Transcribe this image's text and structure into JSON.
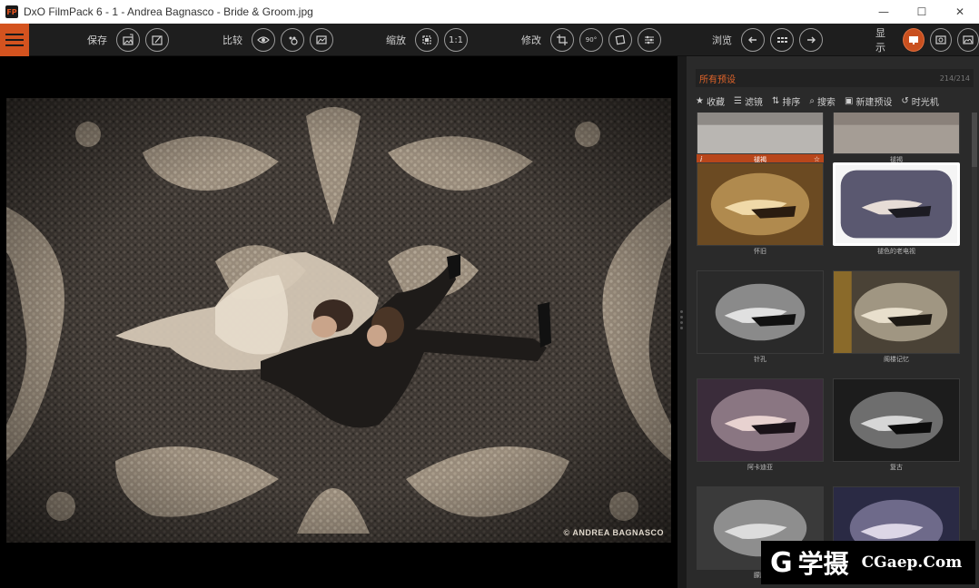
{
  "window": {
    "logo_text": "FP",
    "title": "DxO FilmPack 6 - 1 - Andrea Bagnasco - Bride & Groom.jpg",
    "minimize": "—",
    "maximize": "☐",
    "close": "✕"
  },
  "toolbar": {
    "save_label": "保存",
    "compare_label": "比较",
    "zoom_label": "缩放",
    "zoom_ratio": "1:1",
    "edit_label": "修改",
    "rotate_label": "90°",
    "browse_label": "浏览",
    "display_label": "显示"
  },
  "photo": {
    "credit": "© ANDREA BAGNASCO"
  },
  "panel": {
    "title": "所有预设",
    "count": "214/214",
    "tools": [
      {
        "icon": "★",
        "label": "收藏"
      },
      {
        "icon": "☰",
        "label": "滤镜"
      },
      {
        "icon": "⇅",
        "label": "排序"
      },
      {
        "icon": "⌕",
        "label": "搜索"
      },
      {
        "icon": "▣",
        "label": "新建预设"
      },
      {
        "icon": "↺",
        "label": "时光机"
      }
    ],
    "presets": [
      {
        "label": "褪褐",
        "selected": true
      },
      {
        "label": "褪褐"
      },
      {
        "label": "怀旧"
      },
      {
        "label": "褪色的老电视",
        "framed": true
      },
      {
        "label": "针孔"
      },
      {
        "label": "阁楼记忆"
      },
      {
        "label": "阿卡迪亚"
      },
      {
        "label": "复古"
      },
      {
        "label": "朦胧"
      },
      {
        "label": ""
      }
    ]
  },
  "watermark": {
    "logo": "G",
    "name": "学摄",
    "site": "CGaep.Com"
  },
  "colors": {
    "accent": "#d4531f",
    "toolbar_bg": "#1e1e1e",
    "panel_bg": "#2a2a2a"
  }
}
